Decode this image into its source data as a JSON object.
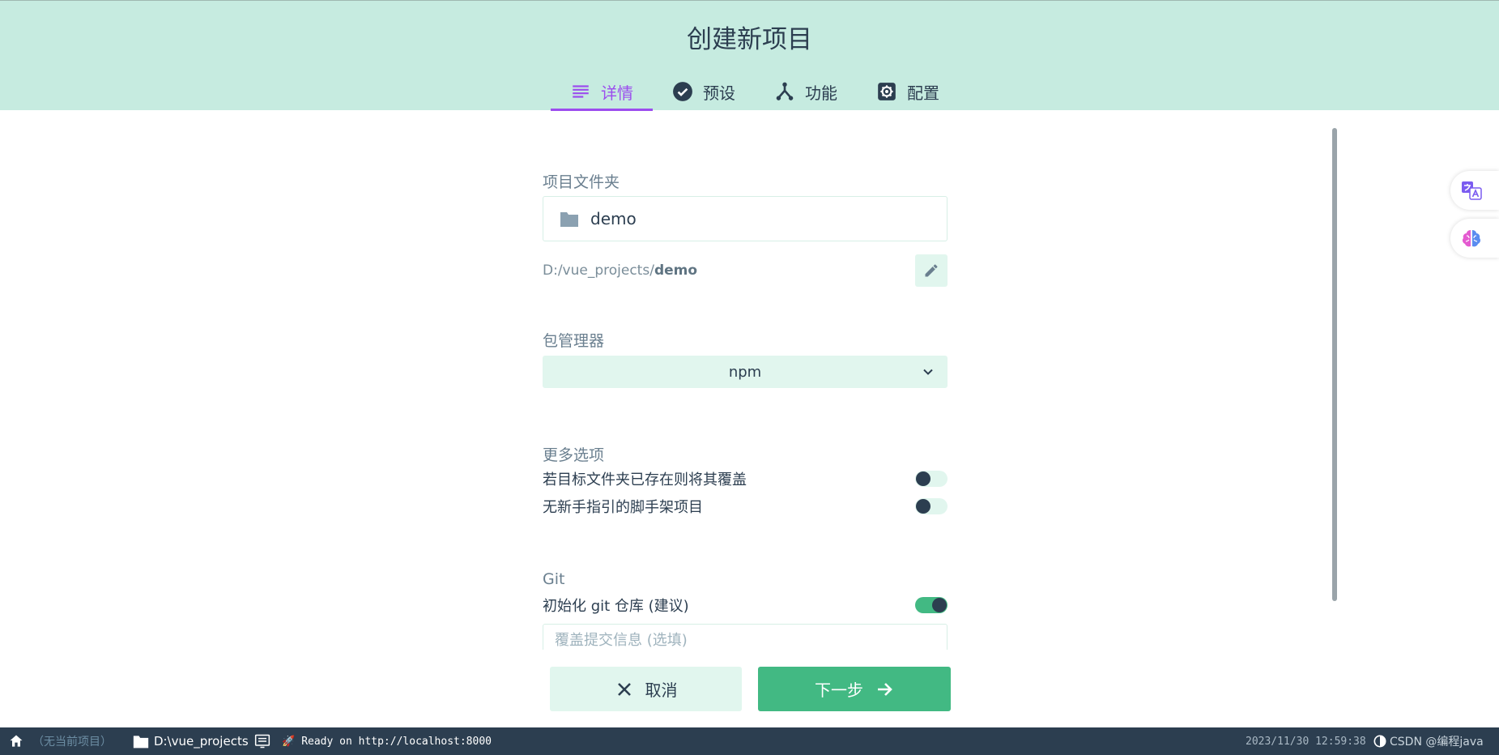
{
  "header": {
    "title": "创建新项目",
    "tabs": [
      {
        "label": "详情",
        "icon": "list-icon",
        "active": true
      },
      {
        "label": "预设",
        "icon": "check-circle-icon",
        "active": false
      },
      {
        "label": "功能",
        "icon": "fork-icon",
        "active": false
      },
      {
        "label": "配置",
        "icon": "gear-icon",
        "active": false
      }
    ]
  },
  "form": {
    "folder": {
      "label": "项目文件夹",
      "value": "demo",
      "path_prefix": "D:/vue_projects/",
      "path_name": "demo"
    },
    "package_manager": {
      "label": "包管理器",
      "selected": "npm"
    },
    "more_options": {
      "label": "更多选项",
      "force": {
        "label": "若目标文件夹已存在则将其覆盖",
        "on": false
      },
      "bare": {
        "label": "无新手指引的脚手架项目",
        "on": false
      }
    },
    "git": {
      "label": "Git",
      "init": {
        "label": "初始化 git 仓库 (建议)",
        "on": true
      },
      "commit_placeholder": "覆盖提交信息 (选填)"
    }
  },
  "actions": {
    "cancel_label": "取消",
    "next_label": "下一步"
  },
  "statusbar": {
    "project": "（无当前项目）",
    "cwd": "D:\\vue_projects",
    "log": "Ready on http://localhost:8000",
    "timestamp": "2023/11/30 12:59:38",
    "watermark": "CSDN @编程java"
  },
  "colors": {
    "header_bg": "#c6ebe0",
    "accent_purple": "#9c4dee",
    "primary_green": "#42b983",
    "light_green": "#e1f6ee",
    "dark": "#2c3e50"
  }
}
